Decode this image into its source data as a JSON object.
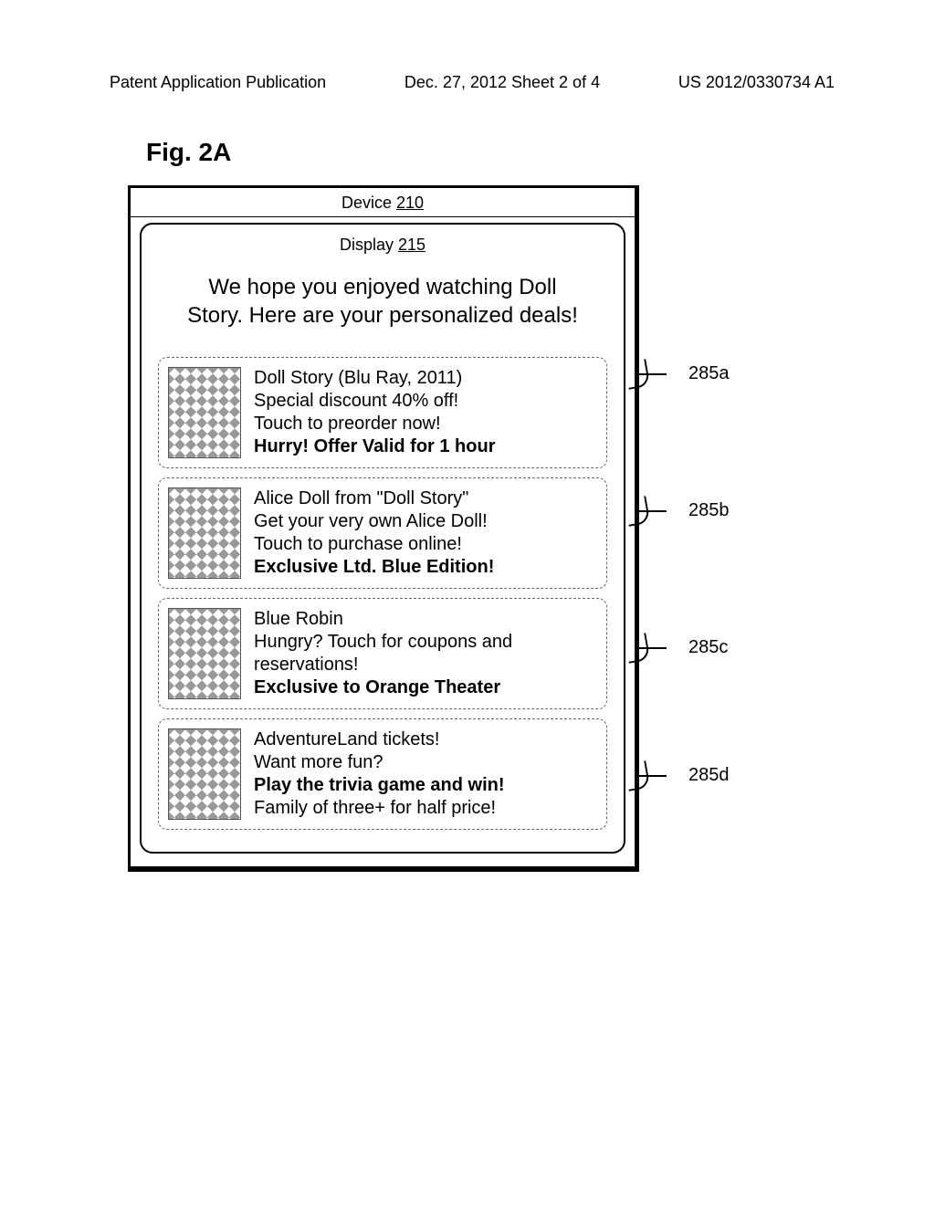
{
  "header": {
    "left": "Patent Application Publication",
    "center": "Dec. 27, 2012  Sheet 2 of 4",
    "right": "US 2012/0330734 A1"
  },
  "figure": {
    "label": "Fig. 2A",
    "device_label_prefix": "Device ",
    "device_ref": "210",
    "display_label_prefix": "Display ",
    "display_ref": "215",
    "intro": "We hope you enjoyed watching Doll Story. Here are your personalized deals!",
    "deals": [
      {
        "callout": "285a",
        "lines": [
          {
            "text": "Doll Story (Blu Ray, 2011)",
            "bold": false
          },
          {
            "text": "Special discount 40% off!",
            "bold": false
          },
          {
            "text": "Touch to preorder now!",
            "bold": false
          },
          {
            "text": "Hurry! Offer Valid for 1 hour",
            "bold": true
          }
        ]
      },
      {
        "callout": "285b",
        "lines": [
          {
            "text": "Alice Doll from \"Doll Story\"",
            "bold": false
          },
          {
            "text": "Get your very own Alice Doll!",
            "bold": false
          },
          {
            "text": "Touch to purchase online!",
            "bold": false
          },
          {
            "text": "Exclusive Ltd. Blue Edition!",
            "bold": true
          }
        ]
      },
      {
        "callout": "285c",
        "lines": [
          {
            "text": "Blue Robin",
            "bold": false
          },
          {
            "text": "Hungry? Touch for coupons and reservations!",
            "bold": false
          },
          {
            "text": "Exclusive to Orange Theater",
            "bold": true
          }
        ]
      },
      {
        "callout": "285d",
        "lines": [
          {
            "text": "AdventureLand tickets!",
            "bold": false
          },
          {
            "text": "Want more fun?",
            "bold": false
          },
          {
            "text": "Play the trivia game and win!",
            "bold": true
          },
          {
            "text": "Family of three+ for half price!",
            "bold": false
          }
        ]
      }
    ]
  }
}
